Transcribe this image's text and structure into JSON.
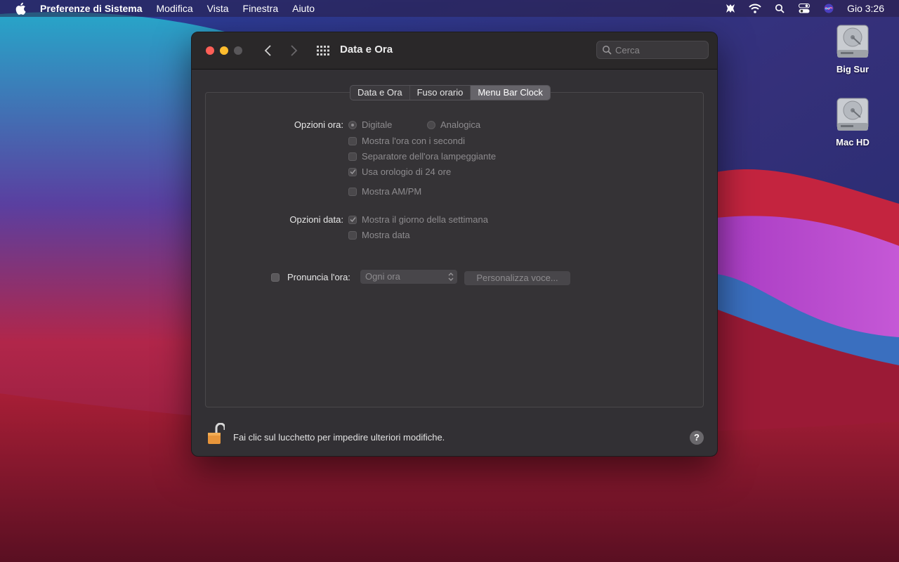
{
  "menubar": {
    "app_name": "Preferenze di Sistema",
    "items": [
      "Modifica",
      "Vista",
      "Finestra",
      "Aiuto"
    ],
    "clock": "Gio 3:26",
    "status_icons": [
      "chess-knight-icon",
      "wifi-icon",
      "spotlight-search-icon",
      "control-center-icon",
      "siri-icon"
    ]
  },
  "desktop": {
    "icons": [
      {
        "label": "Big Sur",
        "icon": "hard-drive-icon"
      },
      {
        "label": "Mac HD",
        "icon": "hard-drive-icon"
      }
    ]
  },
  "window": {
    "title": "Data e Ora",
    "search_placeholder": "Cerca",
    "tabs": [
      {
        "label": "Data e Ora",
        "active": false
      },
      {
        "label": "Fuso orario",
        "active": false
      },
      {
        "label": "Menu Bar Clock",
        "active": true
      }
    ],
    "time_options": {
      "label": "Opzioni ora:",
      "digital": "Digitale",
      "analog": "Analogica",
      "show_seconds": "Mostra l'ora con i secondi",
      "flash_separator": "Separatore dell'ora lampeggiante",
      "use_24h": "Usa orologio di 24 ore",
      "show_ampm": "Mostra AM/PM"
    },
    "date_options": {
      "label": "Opzioni data:",
      "show_weekday": "Mostra il giorno della settimana",
      "show_date": "Mostra data"
    },
    "announce": {
      "label": "Pronuncia l'ora:",
      "interval": "Ogni ora",
      "customize_button": "Personalizza voce..."
    },
    "footer": {
      "lock_text": "Fai clic sul lucchetto per impedire ulteriori modifiche.",
      "help": "?"
    }
  },
  "colors": {
    "close": "#fe5f57",
    "minimize": "#febc2e",
    "window_bg": "#323034",
    "lock": "#e8953a"
  }
}
